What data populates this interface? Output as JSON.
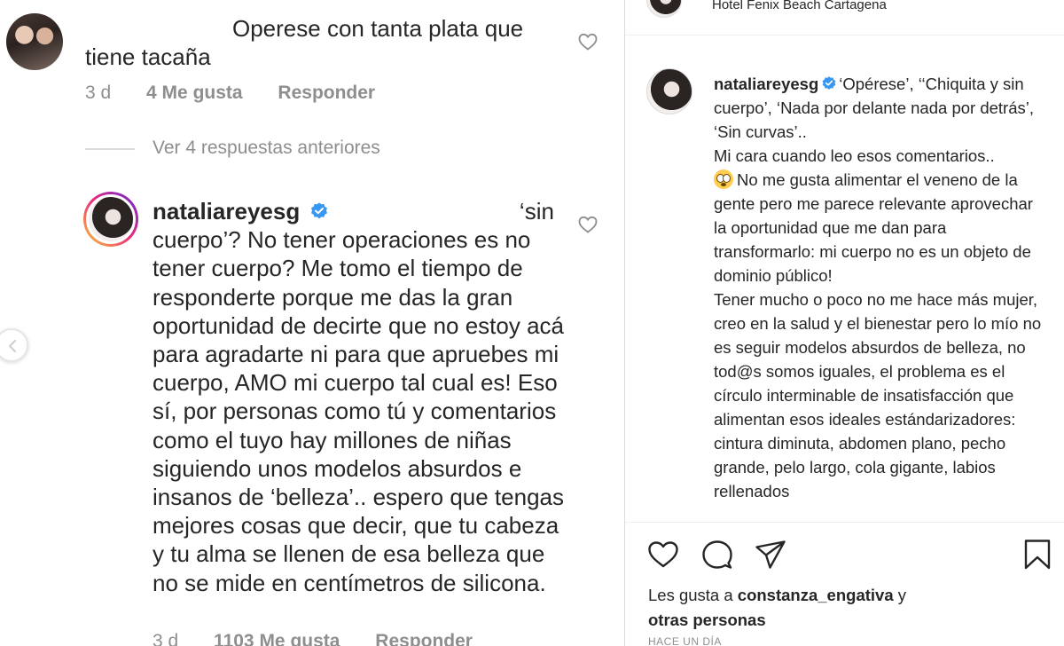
{
  "left_panel": {
    "comment1": {
      "text_a": "Operese con tanta plata que",
      "text_b": "tiene tacaña",
      "time": "3 d",
      "likes": "4 Me gusta",
      "reply": "Responder"
    },
    "view_replies": "Ver 4 respuestas anteriores",
    "comment2": {
      "username": "nataliareyesg",
      "text_start": "‘sin",
      "text_body": "cuerpo’? No tener operaciones es no tener cuerpo? Me tomo el tiempo de responderte porque me das la gran oportunidad de decirte que no estoy acá para agradarte ni para que apruebes mi cuerpo, AMO mi cuerpo tal cual es! Eso sí, por personas como tú y comentarios como el tuyo hay millones de niñas siguiendo unos modelos absurdos e insanos de ‘belleza’.. espero que tengas mejores cosas que decir, que tu cabeza y tu alma se llenen de esa belleza que no se mide en centímetros de silicona.",
      "time": "3 d",
      "likes": "1103 Me gusta",
      "reply": "Responder"
    }
  },
  "right_panel": {
    "location": "Hotel Fenix Beach Cartagena",
    "caption": {
      "username": "nataliareyesg",
      "line1": "‘Opérese’, ‘‘Chiquita y sin cuerpo’, ‘Nada por delante nada por detrás’, ‘Sin curvas’..",
      "line2": "Mi cara cuando leo esos comentarios..",
      "line3": "No me gusta alimentar el veneno de la gente pero me parece relevante aprovechar la oportunidad que me dan para transformarlo: mi cuerpo no es un objeto de dominio público!",
      "line4": "Tener mucho o poco no me hace más mujer, creo en la salud y el bienestar pero lo mío no es seguir modelos absurdos de belleza, no tod@s somos iguales, el problema es el círculo interminable de insatisfacción que alimentan esos ideales estándarizadores: cintura diminuta, abdomen plano, pecho grande, pelo largo, cola gigante, labios rellenados"
    },
    "likes": {
      "prefix": "Les gusta a",
      "user": "constanza_engativa",
      "conj": "y",
      "others": "otras personas"
    },
    "time": "HACE UN DÍA"
  },
  "icons": {
    "heart": "heart-icon",
    "comment": "comment-icon",
    "share": "share-icon",
    "save": "bookmark-icon",
    "verified": "verified-badge-icon",
    "prev": "chevron-left-icon"
  },
  "colors": {
    "text": "#262626",
    "muted": "#8e8e8e",
    "verified": "#3897f0"
  }
}
